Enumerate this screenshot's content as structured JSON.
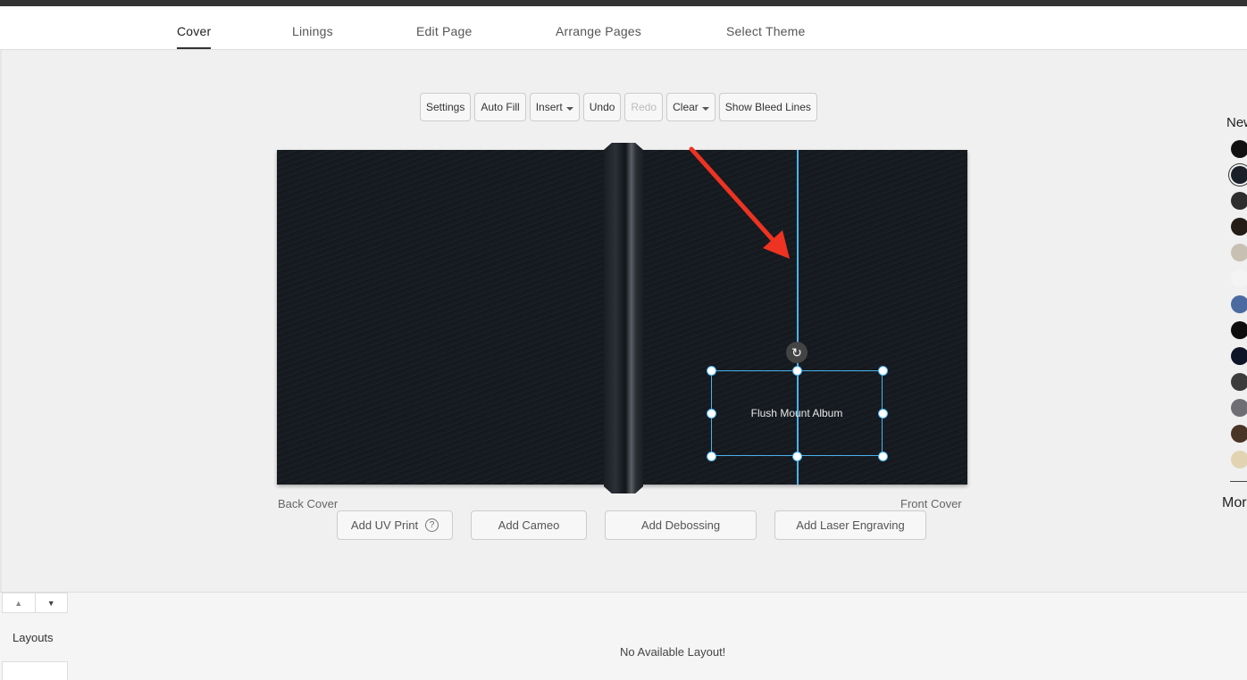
{
  "tabs": [
    {
      "label": "Cover",
      "active": true
    },
    {
      "label": "Linings",
      "active": false
    },
    {
      "label": "Edit Page",
      "active": false
    },
    {
      "label": "Arrange Pages",
      "active": false
    },
    {
      "label": "Select Theme",
      "active": false
    }
  ],
  "toolbar": {
    "settings": "Settings",
    "auto_fill": "Auto Fill",
    "insert": "Insert",
    "undo": "Undo",
    "redo": "Redo",
    "clear": "Clear",
    "show_bleed": "Show Bleed Lines"
  },
  "canvas": {
    "text_box": "Flush Mount Album",
    "back_label": "Back Cover",
    "front_label": "Front Cover",
    "cover_color": "#161b20",
    "selection_color": "#4ab3f0",
    "annotation_arrow_color": "#ee3322"
  },
  "actions": {
    "uv_print": "Add UV Print",
    "uv_help": "?",
    "cameo": "Add Cameo",
    "debossing": "Add Debossing",
    "laser": "Add Laser Engraving"
  },
  "right_panel": {
    "title": "New",
    "more": "More",
    "swatches": [
      "#111111",
      "#1a2028",
      "#2e2e2e",
      "#241c17",
      "#c9c0b4",
      "#f4f4f4",
      "#4b6aa0",
      "#0d0d0d",
      "#0f1528",
      "#3c3c3c",
      "#6e6e74",
      "#4a3526",
      "#e2d3b3"
    ],
    "selected_swatch": 1
  },
  "bottom": {
    "layouts_label": "Layouts",
    "no_layout": "No Available Layout!",
    "up_icon": "▲",
    "down_icon": "▼"
  }
}
